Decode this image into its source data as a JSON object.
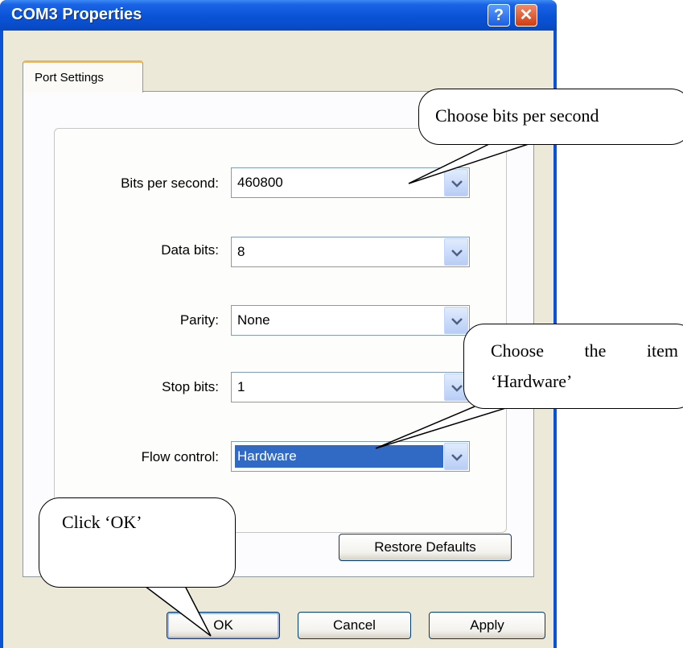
{
  "window": {
    "title": "COM3 Properties",
    "help_glyph": "?",
    "close_glyph": "✕"
  },
  "tabs": [
    {
      "label": "Port Settings"
    }
  ],
  "fields": {
    "bits_per_second": {
      "label": "Bits per second:",
      "value": "460800"
    },
    "data_bits": {
      "label": "Data bits:",
      "value": "8"
    },
    "parity": {
      "label": "Parity:",
      "value": "None"
    },
    "stop_bits": {
      "label": "Stop bits:",
      "value": "1"
    },
    "flow_control": {
      "label": "Flow control:",
      "value": "Hardware"
    }
  },
  "buttons": {
    "restore_defaults": "Restore Defaults",
    "ok": "OK",
    "cancel": "Cancel",
    "apply": "Apply"
  },
  "callouts": {
    "bits": "Choose bits per second",
    "hardware_line1": "Choose the item",
    "hardware_line2": "‘Hardware’",
    "ok": "Click ‘OK’"
  },
  "colors": {
    "titlebar": "#0a53d6",
    "selection": "#316ac5",
    "tab_accent": "#f6b541"
  }
}
